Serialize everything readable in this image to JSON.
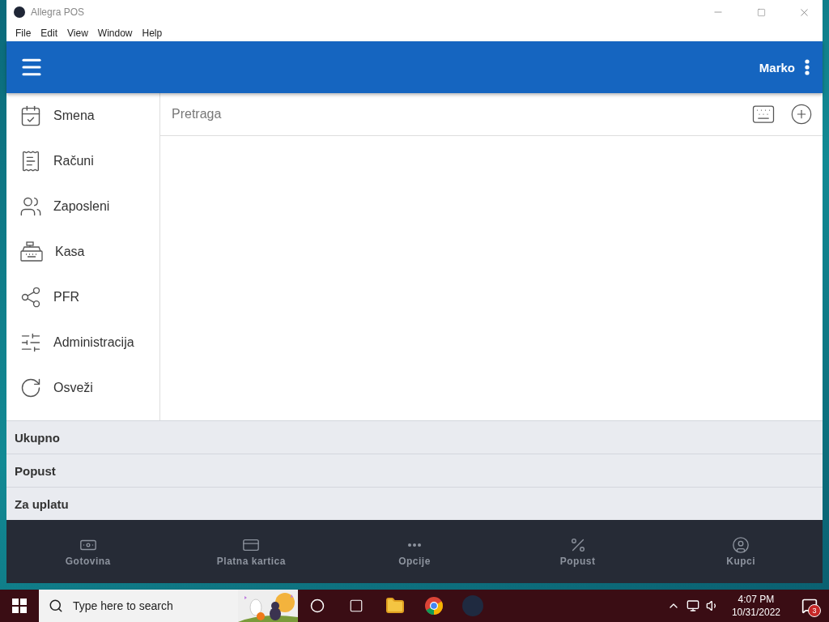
{
  "window": {
    "title": "Allegra POS"
  },
  "menu": [
    "File",
    "Edit",
    "View",
    "Window",
    "Help"
  ],
  "header": {
    "user": "Marko"
  },
  "sidebar": {
    "items": [
      {
        "label": "Smena",
        "kind": "shift"
      },
      {
        "label": "Računi",
        "kind": "receipts"
      },
      {
        "label": "Zaposleni",
        "kind": "staff"
      },
      {
        "label": "Kasa",
        "kind": "register"
      },
      {
        "label": "PFR",
        "kind": "network"
      },
      {
        "label": "Administracija",
        "kind": "admin"
      },
      {
        "label": "Osveži",
        "kind": "refresh"
      }
    ]
  },
  "search": {
    "placeholder": "Pretraga"
  },
  "totals": [
    "Ukupno",
    "Popust",
    "Za uplatu"
  ],
  "actions": [
    {
      "label": "Gotovina",
      "kind": "cash"
    },
    {
      "label": "Platna kartica",
      "kind": "card"
    },
    {
      "label": "Opcije",
      "kind": "more"
    },
    {
      "label": "Popust",
      "kind": "discount"
    },
    {
      "label": "Kupci",
      "kind": "customer"
    }
  ],
  "taskbar": {
    "search_placeholder": "Type here to search",
    "time": "4:07 PM",
    "date": "10/31/2022",
    "notifications": "3"
  }
}
